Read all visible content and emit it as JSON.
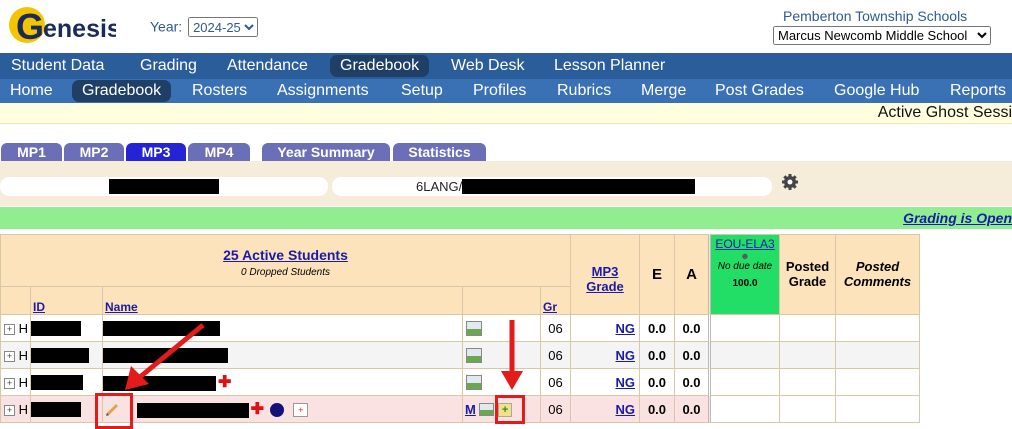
{
  "header": {
    "logo_text": "Genesis",
    "year_label": "Year:",
    "year_value": "2024-25",
    "district": "Pemberton Township Schools",
    "school": "Marcus Newcomb Middle School"
  },
  "nav1": [
    "Student Data",
    "Grading",
    "Attendance",
    "Gradebook",
    "Web Desk",
    "Lesson Planner"
  ],
  "nav2": [
    "Home",
    "Gradebook",
    "Rosters",
    "Assignments",
    "Setup",
    "Profiles",
    "Rubrics",
    "Merge",
    "Post Grades",
    "Google Hub",
    "Reports"
  ],
  "ghost_text": "Active Ghost Sessi",
  "tabs": [
    "MP1",
    "MP2",
    "MP3",
    "MP4",
    "Year Summary",
    "Statistics"
  ],
  "course_prefix": "6LANG/",
  "grading_status": "Grading is Open",
  "table": {
    "active_students": "25 Active Students",
    "dropped_students": "0 Dropped Students",
    "col_id": "ID",
    "col_name": "Name",
    "col_gr": "Gr",
    "col_mp3_grade_1": "MP3",
    "col_mp3_grade_2": "Grade",
    "col_e": "E",
    "col_a": "A",
    "assignment_code": "EOU-ELA3",
    "assignment_due": "No due date",
    "assignment_points": "100.0",
    "col_posted_grade_1": "Posted",
    "col_posted_grade_2": "Grade",
    "col_posted_comments_1": "Posted",
    "col_posted_comments_2": "Comments",
    "rows": [
      {
        "status": "H",
        "grade": "06",
        "mp3": "NG",
        "e": "0.0",
        "a": "0.0"
      },
      {
        "status": "H",
        "grade": "06",
        "mp3": "NG",
        "e": "0.0",
        "a": "0.0"
      },
      {
        "status": "H",
        "grade": "06",
        "mp3": "NG",
        "e": "0.0",
        "a": "0.0"
      },
      {
        "status": "H",
        "grade": "06",
        "mp3": "NG",
        "e": "0.0",
        "a": "0.0"
      }
    ]
  },
  "colors": {
    "nav1_bg": "#2b5d9a",
    "nav2_bg": "#3a71b5",
    "active_tab": "#2424d6",
    "tab": "#6a6fb8",
    "green_bar": "#90ee90",
    "assignment_bg": "#22dd66",
    "annotation": "#e41b1b"
  },
  "icons": [
    "gear-icon",
    "picture-icon",
    "pencil-icon",
    "red-cross-icon",
    "blue-dot-icon",
    "medical-kit-icon",
    "m-icon",
    "add-plus-icon",
    "expand-plus-icon"
  ]
}
